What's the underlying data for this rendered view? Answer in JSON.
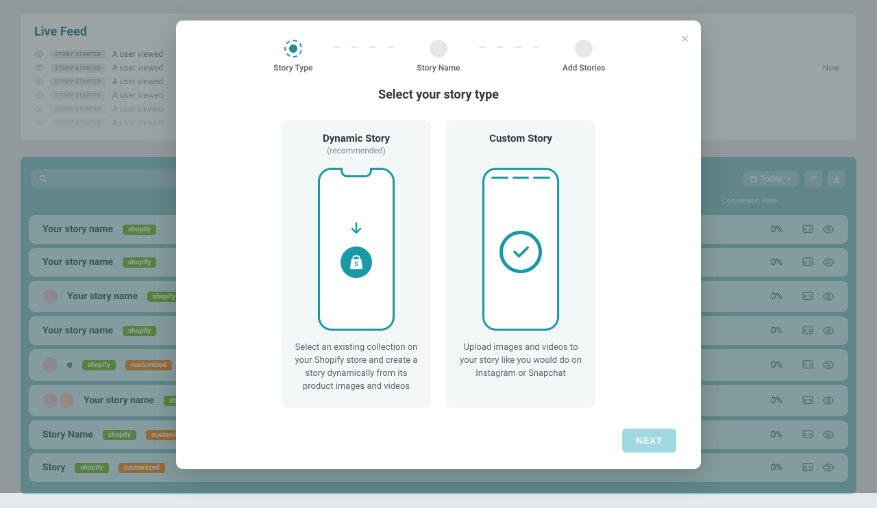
{
  "live_feed": {
    "title": "Live Feed",
    "tag": "STORY STARTED",
    "row_text": "A user viewed",
    "now_label": "Now",
    "row_count": 6
  },
  "toolbar": {
    "today_label": "Today",
    "conversion_header": "Conversion Rate"
  },
  "stories": [
    {
      "name": "Your story name",
      "tags": [
        "shopify"
      ],
      "rate": "0%"
    },
    {
      "name": "Your story name",
      "tags": [
        "shopify"
      ],
      "rate": "0%"
    },
    {
      "name": "Your story name",
      "tags": [
        "shopify"
      ],
      "rate": "0%",
      "avatar": true
    },
    {
      "name": "Your story name",
      "tags": [
        "shopify"
      ],
      "rate": "0%"
    },
    {
      "name": "e",
      "tags": [
        "shopify",
        "customized"
      ],
      "rate": "0%",
      "avatar": true
    },
    {
      "name": "Your story name",
      "tags": [
        "shopify"
      ],
      "rate": "0%",
      "double_avatar": true
    },
    {
      "name": "Story Name",
      "tags": [
        "shopify",
        "customized"
      ],
      "rate": "0%"
    },
    {
      "name": "Story",
      "tags": [
        "shopify",
        "customized"
      ],
      "rate": "0%"
    }
  ],
  "tag_labels": {
    "shopify": "shopify",
    "customized": "customized"
  },
  "modal": {
    "steps": [
      "Story Type",
      "Story Name",
      "Add Stories"
    ],
    "title": "Select your story type",
    "cards": {
      "dynamic": {
        "title": "Dynamic Story",
        "sub": "(recommended)",
        "desc": "Select an existing collection on your Shopify store and create a story dynamically from its product images and videos"
      },
      "custom": {
        "title": "Custom Story",
        "desc": "Upload images and videos to your story like you would do on Instagram or Snapchat"
      }
    },
    "next_label": "NEXT"
  }
}
